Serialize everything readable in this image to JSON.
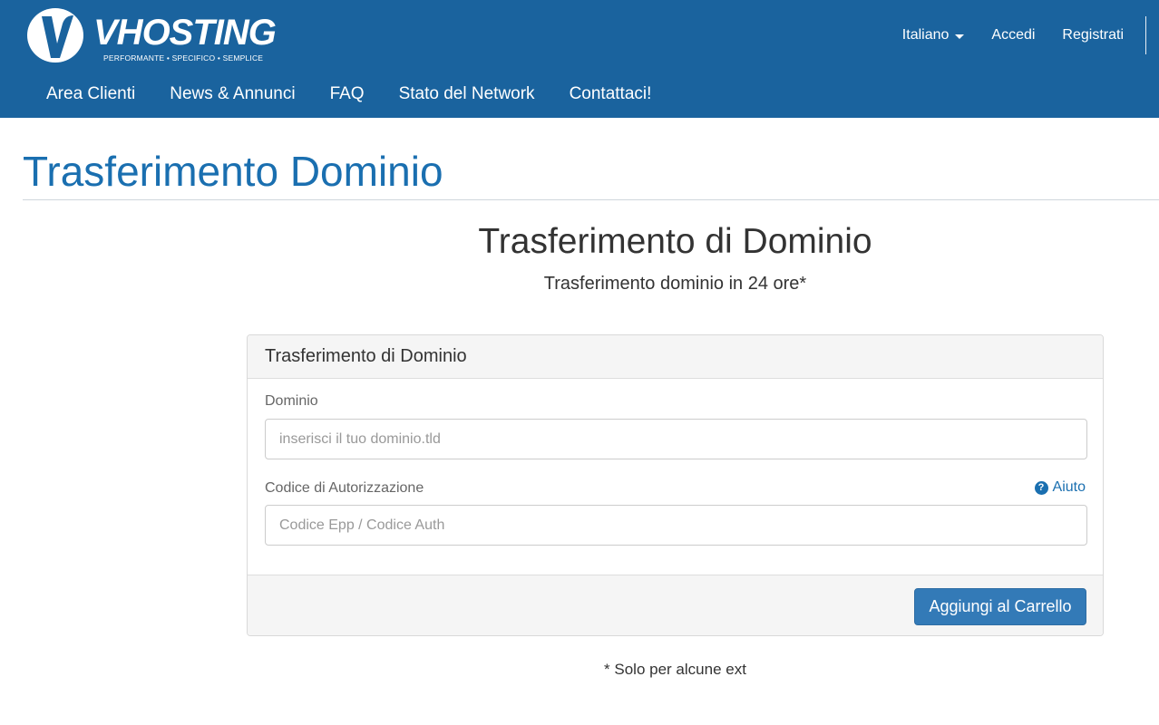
{
  "brand": {
    "name": "VHOSTING",
    "tagline": "PERFORMANTE • SPECIFICO • SEMPLICE",
    "color": "#1a639e"
  },
  "top_links": {
    "language": "Italiano",
    "login": "Accedi",
    "register": "Registrati"
  },
  "nav": {
    "items": [
      "Area Clienti",
      "News & Annunci",
      "FAQ",
      "Stato del Network",
      "Contattaci!"
    ]
  },
  "page": {
    "title": "Trasferimento Dominio",
    "heading": "Trasferimento di Dominio",
    "subheading": "Trasferimento dominio in 24 ore*"
  },
  "panel": {
    "title": "Trasferimento di Dominio",
    "domain_label": "Dominio",
    "domain_placeholder": "inserisci il tuo dominio.tld",
    "domain_value": "",
    "auth_label": "Codice di Autorizzazione",
    "auth_placeholder": "Codice Epp / Codice Auth",
    "auth_value": "",
    "help_label": "Aiuto",
    "help_icon": "question-circle-icon",
    "submit_label": "Aggiungi al Carrello",
    "accent_color": "#337ab7"
  },
  "footnote": "* Solo per alcune ext"
}
